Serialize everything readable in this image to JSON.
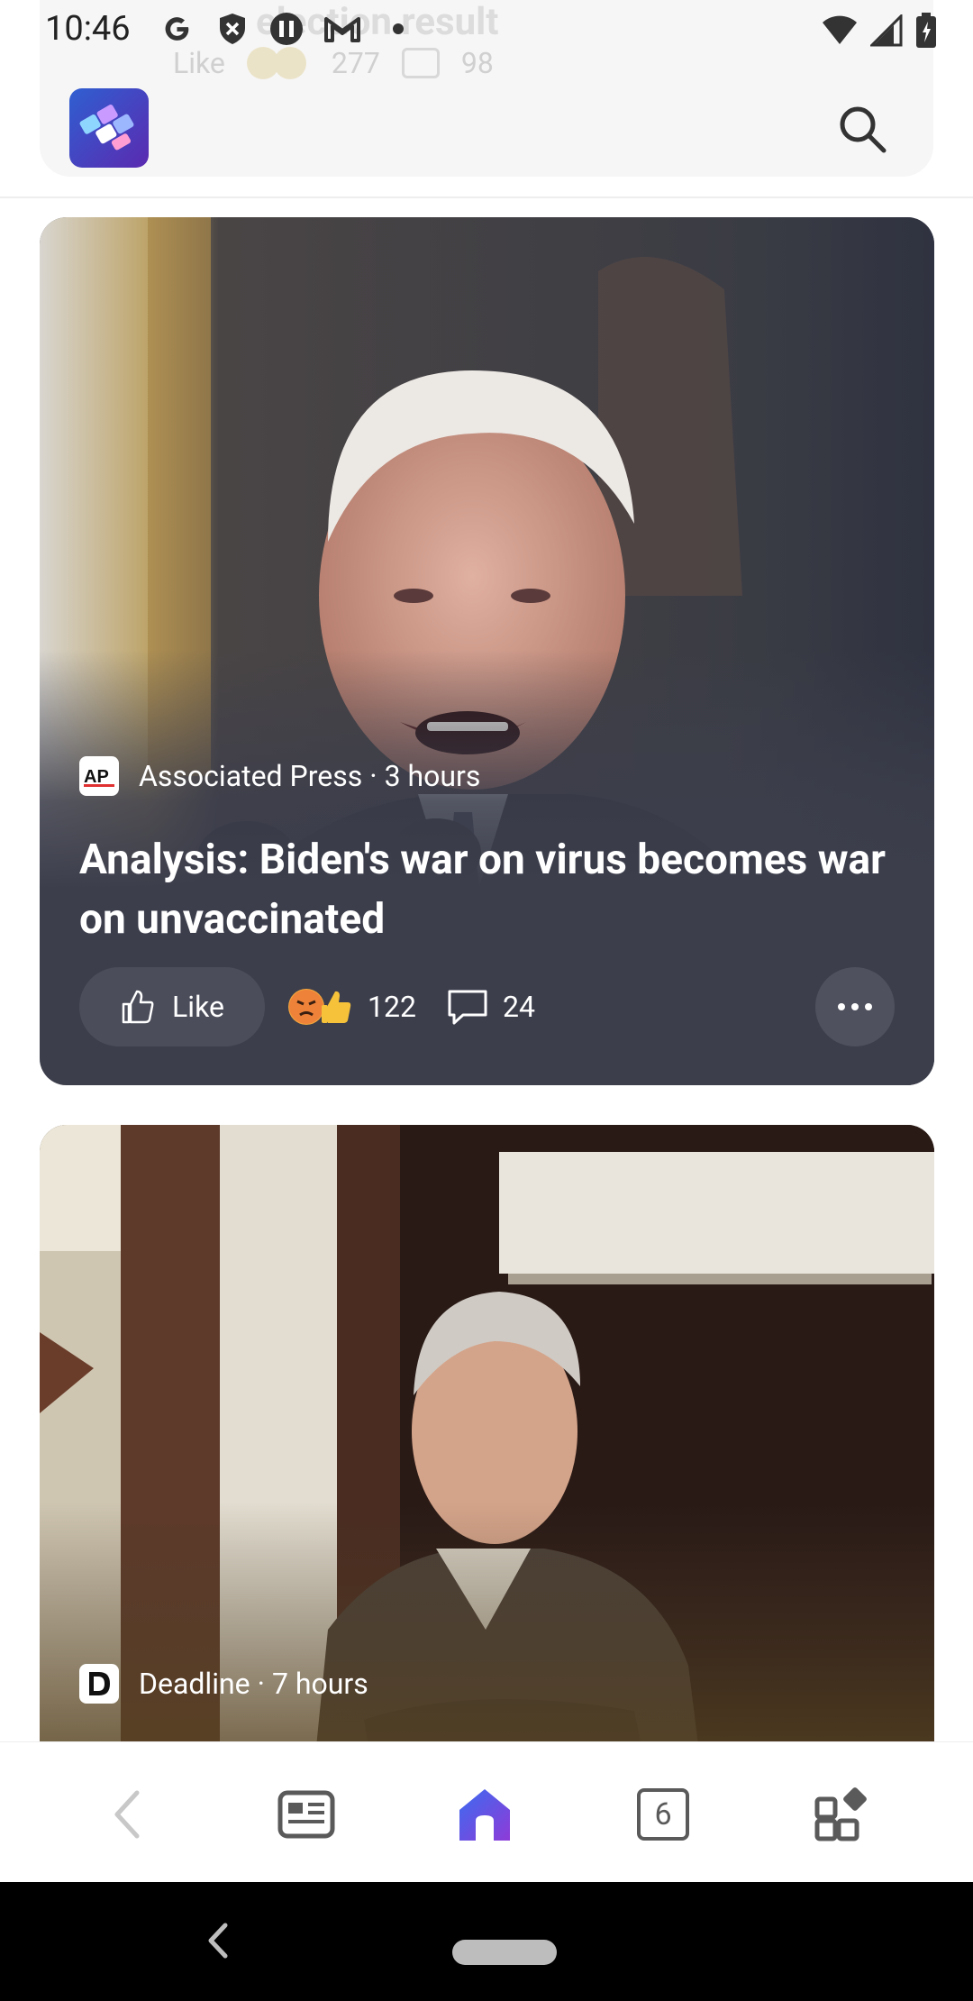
{
  "status_bar": {
    "time": "10:46",
    "notification_icons": [
      "google-icon",
      "shield-icon",
      "info-icon",
      "gmail-icon",
      "dot-icon"
    ],
    "system_icons": [
      "wifi-icon",
      "signal-icon",
      "battery-icon"
    ]
  },
  "previous_card": {
    "title_fragment": "election result",
    "like_label": "Like",
    "reaction_count": "277",
    "comment_count": "98"
  },
  "header": {
    "app_icon": "microsoft-start-icon",
    "search_icon": "search-icon"
  },
  "feed": [
    {
      "source": "Associated Press",
      "separator": "·",
      "age": "3 hours",
      "headline": "Analysis: Biden's war on virus becomes war on unvaccinated",
      "like_label": "Like",
      "reaction_count": "122",
      "reactions": [
        "angry-emoji-icon",
        "thumbs-up-emoji-icon"
      ],
      "comment_count": "24"
    },
    {
      "source": "Deadline",
      "separator": "·",
      "age": "7 hours"
    }
  ],
  "browser_nav": {
    "items": [
      "back-icon",
      "news-icon",
      "home-icon",
      "tabs-icon",
      "apps-icon"
    ],
    "tab_count": "6",
    "active_color": "#5b3fd8"
  }
}
